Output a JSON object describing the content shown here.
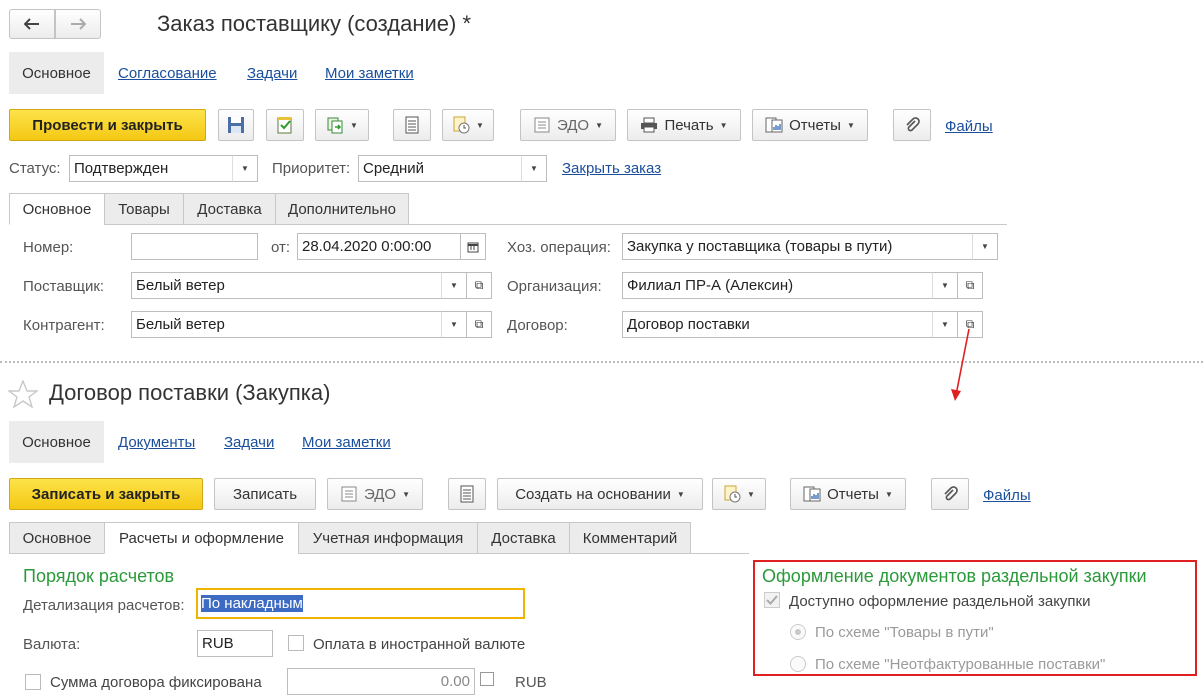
{
  "top": {
    "title": "Заказ поставщику (создание) *",
    "nav": [
      "Основное",
      "Согласование",
      "Задачи",
      "Мои заметки"
    ],
    "toolbar": {
      "post_close": "Провести и закрыть",
      "edo": "ЭДО",
      "print": "Печать",
      "reports": "Отчеты",
      "files": "Файлы"
    },
    "status_label": "Статус:",
    "status_value": "Подтвержден",
    "priority_label": "Приоритет:",
    "priority_value": "Средний",
    "close_order": "Закрыть заказ",
    "tabs": [
      "Основное",
      "Товары",
      "Доставка",
      "Дополнительно"
    ],
    "form": {
      "number_label": "Номер:",
      "number_value": "",
      "date_label": "от:",
      "date_value": "28.04.2020  0:00:00",
      "operation_label": "Хоз. операция:",
      "operation_value": "Закупка у поставщика (товары в пути)",
      "supplier_label": "Поставщик:",
      "supplier_value": "Белый ветер",
      "org_label": "Организация:",
      "org_value": "Филиал ПР-А (Алексин)",
      "counterparty_label": "Контрагент:",
      "counterparty_value": "Белый ветер",
      "contract_label": "Договор:",
      "contract_value": "Договор поставки"
    }
  },
  "bottom": {
    "title": "Договор поставки  (Закупка)",
    "nav": [
      "Основное",
      "Документы",
      "Задачи",
      "Мои заметки"
    ],
    "toolbar": {
      "save_close": "Записать и закрыть",
      "save": "Записать",
      "edo": "ЭДО",
      "create_based": "Создать на основании",
      "reports": "Отчеты",
      "files": "Файлы"
    },
    "tabs": [
      "Основное",
      "Расчеты и оформление",
      "Учетная информация",
      "Доставка",
      "Комментарий"
    ],
    "settlement_heading": "Порядок расчетов",
    "detail_label": "Детализация расчетов:",
    "detail_value": "По накладным",
    "currency_label": "Валюта:",
    "currency_value": "RUB",
    "foreign_payment": "Оплата в иностранной валюте",
    "fixed_sum": "Сумма договора фиксирована",
    "sum_value": "0.00",
    "sum_currency": "RUB",
    "separate": {
      "heading": "Оформление документов раздельной закупки",
      "available": "Доступно оформление раздельной закупки",
      "scheme_transit": "По схеме \"Товары в пути\"",
      "scheme_uninvoiced": "По схеме \"Неотфактурованные поставки\""
    }
  },
  "colors": {
    "accent_yellow": "#f4c814",
    "link_blue": "#1b4f9c",
    "heading_green": "#2b9a3a",
    "highlight_red": "#e02020",
    "focus_orange": "#f0b400"
  }
}
